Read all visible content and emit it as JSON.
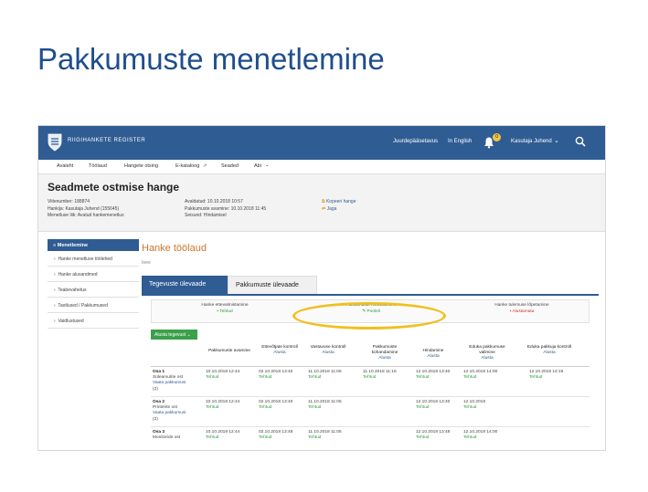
{
  "slide": {
    "title": "Pakkumuste menetlemine"
  },
  "topbar": {
    "logo_text": "RIIGIHANKETE REGISTER",
    "link_help": "Juurdepääsetavus",
    "link_lang": "In English",
    "bell_count": "0",
    "user": "Kasutaja Juhend"
  },
  "nav": {
    "items": [
      "Avaleht",
      "Töölaud",
      "Hangete otsing",
      "E-kataloog",
      "Seaded",
      "Abi"
    ]
  },
  "procurement": {
    "title": "Seadmete ostmise hange",
    "meta_left": [
      "Viitenumber: 188874",
      "Hankija: Kasutaja Juhend (155645)",
      "Menetluse liik: Avatud hankemenetlus"
    ],
    "meta_mid": [
      "Avaldatud: 10.10.2018 10:57",
      "Pakkumuste avamine: 10.10.2018 11:45",
      "Seisund: Hindamisel"
    ],
    "actions": [
      "Kopeeri hange",
      "Jaga"
    ]
  },
  "sidebar": {
    "header": "Menetlemine",
    "items": [
      "Hanke menetluse töölehed",
      "Hanke alusandmed",
      "Teabevahetus",
      "Taotlused / Pakkumused",
      "Vaidlustused"
    ]
  },
  "main": {
    "title": "Hanke töölaud",
    "crumb": "Ieee",
    "tabs": [
      "Tegevuste ülevaade",
      "Pakkumuste ülevaade"
    ]
  },
  "stepper": {
    "steps": [
      {
        "label": "Hanke ettevalmistamine",
        "status": "Tehtud",
        "tone": "green"
      },
      {
        "label": "Pakkumuste menetlemine",
        "status": "Pooleli",
        "tone": "green"
      },
      {
        "label": "Hanke tulemuse lõpetamine",
        "status": "Alustamata",
        "tone": "red"
      }
    ]
  },
  "start_button": "Alusta tegevust",
  "table": {
    "headers": [
      {
        "title": "Pakkumuste avamine",
        "sub": ""
      },
      {
        "title": "Ettevõtjate kontroll",
        "sub": "Alusta"
      },
      {
        "title": "Vastavuse kontroll",
        "sub": "Alusta"
      },
      {
        "title": "Pakkumuste kohandamine",
        "sub": "Alusta"
      },
      {
        "title": "Hindamine",
        "sub": "Alusta"
      },
      {
        "title": "Eduka pakkumuse valimine",
        "sub": "Alusta"
      },
      {
        "title": "Eduka pakkuja kontroll",
        "sub": "Alusta"
      }
    ],
    "rows": [
      {
        "name": "Osa 1",
        "subname": "Sülearvutite ost",
        "link": "Vaata pakkumusi",
        "count": "(2)",
        "cells": [
          [
            "10.10.2018 12:44",
            "Tehtud"
          ],
          [
            "02.10.2018 13:40",
            "Tehtud"
          ],
          [
            "11.10.2018 11:05",
            "Tehtud"
          ],
          [
            "11.10.2018 11:16",
            "Tehtud"
          ],
          [
            "12.10.2018 13:40",
            "Tehtud"
          ],
          [
            "12.10.2018 14:00",
            "Tehtud"
          ],
          [
            "12.10.2018 14:19",
            "Tehtud"
          ]
        ]
      },
      {
        "name": "Osa 2",
        "subname": "Printerite ost",
        "link": "Vaata pakkumusi",
        "count": "(2)",
        "cells": [
          [
            "10.10.2018 12:44",
            "Tehtud"
          ],
          [
            "02.10.2018 13:40",
            "Tehtud"
          ],
          [
            "11.10.2018 11:05",
            "Tehtud"
          ],
          [
            "",
            ""
          ],
          [
            "12.10.2018 13:40",
            "Tehtud"
          ],
          [
            "12.10.2018",
            "Tehtud"
          ],
          [
            "",
            ""
          ]
        ]
      },
      {
        "name": "Osa 3",
        "subname": "Monitoride ost",
        "link": "",
        "count": "",
        "cells": [
          [
            "10.10.2018 12:44",
            "Tehtud"
          ],
          [
            "02.10.2018 13:48",
            "Tehtud"
          ],
          [
            "11.10.2018 11:05",
            "Tehtud"
          ],
          [
            "",
            ""
          ],
          [
            "12.10.2018 13:48",
            "Tehtud"
          ],
          [
            "12.10.2018 14:00",
            "Tehtud"
          ],
          [
            "",
            ""
          ]
        ]
      }
    ]
  },
  "colors": {
    "brand": "#2f5c93",
    "accent": "#c9772b",
    "success": "#2a9a3f",
    "highlight": "#f0c020"
  }
}
